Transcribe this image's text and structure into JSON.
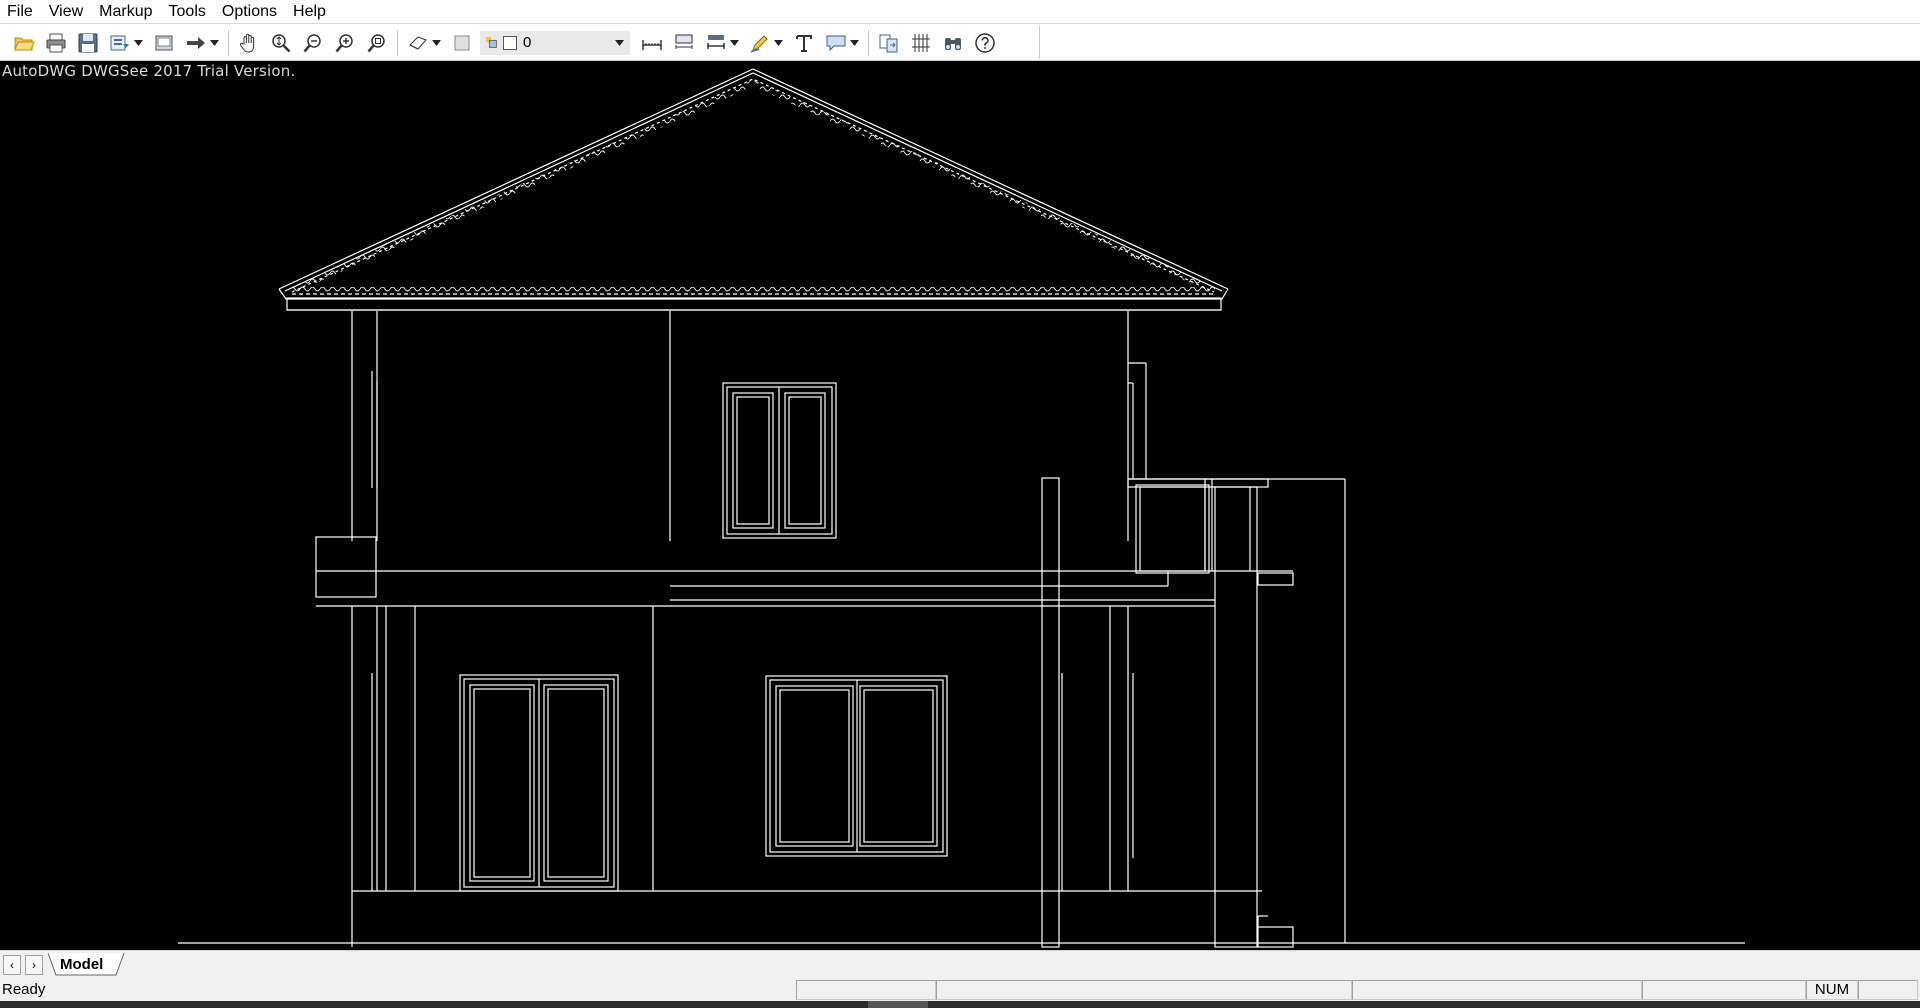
{
  "menu": {
    "items": [
      "File",
      "View",
      "Markup",
      "Tools",
      "Options",
      "Help"
    ]
  },
  "toolbar": {
    "buttons": [
      {
        "name": "open-icon"
      },
      {
        "name": "print-icon"
      },
      {
        "name": "save-icon"
      },
      {
        "name": "export-icon"
      },
      {
        "name": "select-window-icon"
      },
      {
        "name": "arrow-icon"
      },
      {
        "name": "pan-hand-icon"
      },
      {
        "name": "zoom-realtime-icon"
      },
      {
        "name": "zoom-out-icon"
      },
      {
        "name": "zoom-in-icon"
      },
      {
        "name": "zoom-window-icon"
      },
      {
        "name": "layer-state-icon"
      },
      {
        "name": "layer-off-icon"
      },
      {
        "name": "measure-distance-icon"
      },
      {
        "name": "measure-area-icon"
      },
      {
        "name": "dimension-icon"
      },
      {
        "name": "markup-pen-icon"
      },
      {
        "name": "text-icon"
      },
      {
        "name": "callout-icon"
      },
      {
        "name": "compare-icon"
      },
      {
        "name": "hatch-icon"
      },
      {
        "name": "find-binoculars-icon"
      },
      {
        "name": "help-icon"
      }
    ],
    "layer_value": "0"
  },
  "canvas": {
    "trial_text": "AutoDWG DWGSee 2017 Trial Version.",
    "background": "#000000",
    "line_color": "#ffffff"
  },
  "tabs": {
    "prev_label": "‹",
    "next_label": "›",
    "model_label": "Model"
  },
  "status": {
    "text": "Ready",
    "num": "NUM"
  }
}
